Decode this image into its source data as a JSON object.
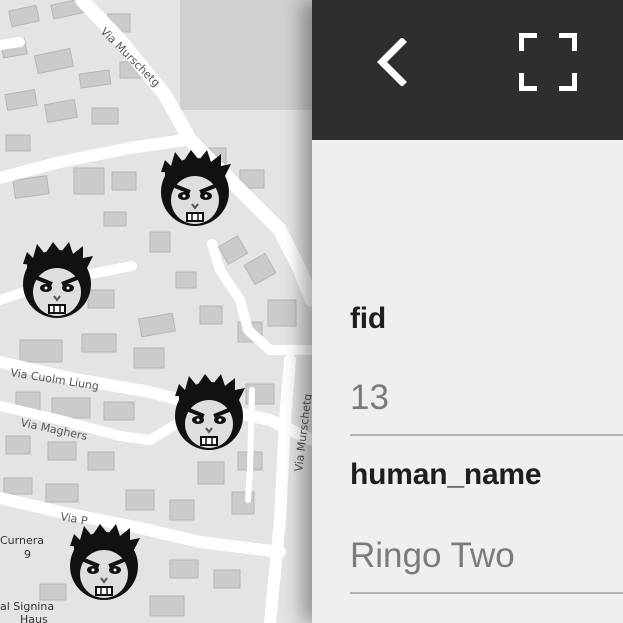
{
  "map": {
    "road_labels": [
      "Via Murschetg",
      "Via Cuolm Liung",
      "Via Maghers",
      "Via Murschetg",
      "Via P"
    ],
    "place_labels": [
      "Curnera",
      "9",
      "al Signina",
      "Haus"
    ],
    "markers": [
      {
        "name": "zombie-marker-1",
        "icon": "zombie-face-icon"
      },
      {
        "name": "zombie-marker-2",
        "icon": "zombie-face-icon"
      },
      {
        "name": "zombie-marker-3",
        "icon": "zombie-face-icon"
      },
      {
        "name": "zombie-marker-4",
        "icon": "zombie-face-icon"
      }
    ]
  },
  "panel": {
    "header": {
      "back_icon": "chevron-left-icon",
      "fullscreen_icon": "fullscreen-icon",
      "background_color": "#2e2e2e"
    },
    "fields": [
      {
        "label": "fid",
        "value": "13"
      },
      {
        "label": "human_name",
        "value": "Ringo Two"
      }
    ]
  }
}
